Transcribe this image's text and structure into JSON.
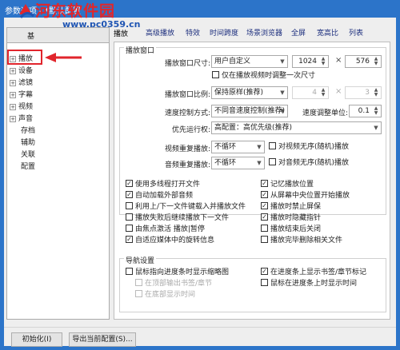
{
  "window": {
    "title": "参数选项 - *默认配置"
  },
  "watermark": {
    "brand": "河东软件园",
    "url": "www.pc0359.cn"
  },
  "tree": {
    "items": [
      {
        "label": "播放",
        "expand": "+"
      },
      {
        "label": "设备",
        "expand": "+"
      },
      {
        "label": "滤镜",
        "expand": "+"
      },
      {
        "label": "字幕",
        "expand": "+"
      },
      {
        "label": "视频",
        "expand": "+"
      },
      {
        "label": "声音",
        "expand": "+"
      },
      {
        "label": "存档",
        "expand": ""
      },
      {
        "label": "辅助",
        "expand": ""
      },
      {
        "label": "关联",
        "expand": ""
      },
      {
        "label": "配置",
        "expand": ""
      }
    ],
    "cut_label": "基 "
  },
  "tabs": [
    "播放",
    "高级播放",
    "特效",
    "时间跨度",
    "场景浏览器",
    "全屏",
    "宽高比",
    "列表"
  ],
  "group_title": "播放窗口",
  "size": {
    "label": "播放窗口尺寸:",
    "select": "用户自定义",
    "width": "1024",
    "height": "576",
    "times": "×"
  },
  "only_first": "仅在播放视频时调整一次尺寸",
  "ratio": {
    "label": "播放窗口比例:",
    "select": "保持原样(推荐)",
    "a": "4",
    "b": "3",
    "times": "×"
  },
  "speed": {
    "label": "速度控制方式:",
    "select": "不同音速度控制(推荐)",
    "unit_label": "速度调整单位:",
    "unit": "0.1"
  },
  "priority": {
    "label": "优先运行权:",
    "select": "高配置：高优先级(推荐)"
  },
  "video_repeat": {
    "label": "视频重复播放:",
    "select": "不循环",
    "check": "对视频无序(随机)播放"
  },
  "audio_repeat": {
    "label": "音频重复播放:",
    "select": "不循环",
    "check": "对音频无序(随机)播放"
  },
  "checks_left": [
    {
      "label": "使用多线程打开文件",
      "checked": true
    },
    {
      "label": "自动加载外部音频",
      "checked": true
    },
    {
      "label": "利用上/下一文件键载入并播放文件",
      "checked": false
    },
    {
      "label": "播放失败后继续播放下一文件",
      "checked": false
    },
    {
      "label": "由焦点激活 播放|暂停",
      "checked": false
    },
    {
      "label": "自适应媒体中的旋转信息",
      "checked": true
    }
  ],
  "checks_right": [
    {
      "label": "记忆播放位置",
      "checked": true
    },
    {
      "label": "从屏幕中央位置开始播放",
      "checked": true
    },
    {
      "label": "播放时禁止屏保",
      "checked": true
    },
    {
      "label": "播放时隐藏指针",
      "checked": true
    },
    {
      "label": "播放结束后关闭",
      "checked": false
    },
    {
      "label": "播放完毕删除相关文件",
      "checked": false
    }
  ],
  "nav": {
    "title": "导航设置",
    "left": {
      "label": "鼠标指向进度条时显示缩略图",
      "checked": false
    },
    "sub1": "在顶部输出书签/章节",
    "sub2": "在底部显示时间",
    "right1": {
      "label": "在进度条上显示书签/章节标记",
      "checked": true
    },
    "right2": {
      "label": "鼠标在进度条上时显示时间",
      "checked": false
    }
  },
  "buttons": {
    "init": "初始化(I)",
    "export": "导出当前配置(S)..."
  },
  "colors": {
    "titlebar": "#2c74c9",
    "highlight": "#e1252c",
    "tab_text": "#1c2e7d",
    "brand": "#e2262a"
  }
}
